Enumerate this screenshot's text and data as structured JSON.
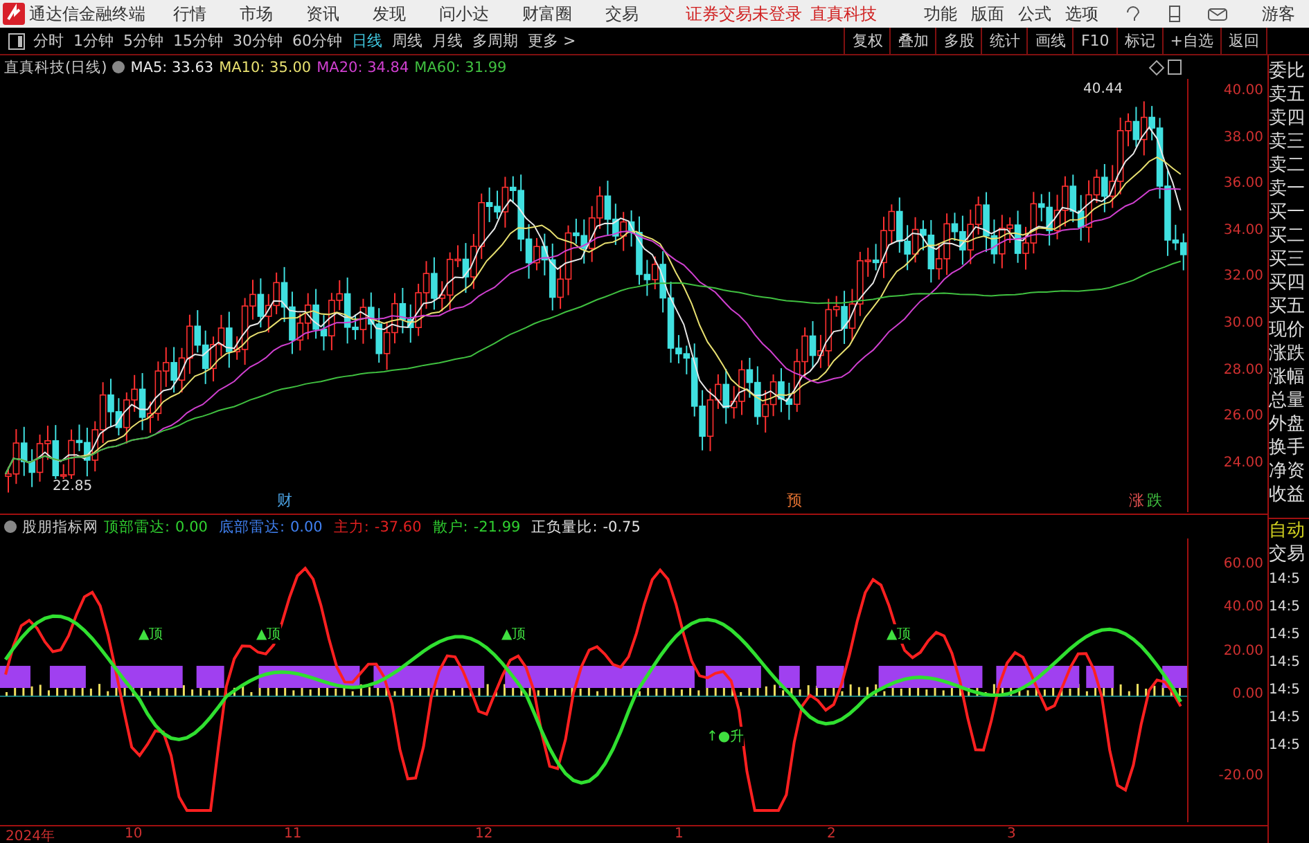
{
  "app_title": "通达信金融终端",
  "menu": [
    "行情",
    "市场",
    "资讯",
    "发现",
    "问小达",
    "财富圈",
    "交易"
  ],
  "login_notice": "证券交易未登录",
  "stock_link": "直真科技",
  "top_menu": [
    "功能",
    "版面",
    "公式",
    "选项"
  ],
  "user": "游客",
  "periods": [
    {
      "label": "分时",
      "selected": false
    },
    {
      "label": "1分钟",
      "selected": false
    },
    {
      "label": "5分钟",
      "selected": false
    },
    {
      "label": "15分钟",
      "selected": false
    },
    {
      "label": "30分钟",
      "selected": false
    },
    {
      "label": "60分钟",
      "selected": false
    },
    {
      "label": "日线",
      "selected": true
    },
    {
      "label": "周线",
      "selected": false
    },
    {
      "label": "月线",
      "selected": false
    },
    {
      "label": "多周期",
      "selected": false
    },
    {
      "label": "更多 >",
      "selected": false
    }
  ],
  "tools": [
    "复权",
    "叠加",
    "多股",
    "统计",
    "画线",
    "F10",
    "标记",
    "+自选",
    "返回"
  ],
  "main_chart": {
    "title": "直真科技(日线)",
    "indicators": [
      {
        "text": "MA5: 33.63",
        "color": "#e8e8e8"
      },
      {
        "text": "MA10: 35.00",
        "color": "#e8e070"
      },
      {
        "text": "MA20: 34.84",
        "color": "#d040d0"
      },
      {
        "text": "MA60: 31.99",
        "color": "#40c040"
      }
    ],
    "y_ticks": [
      "40.00",
      "38.00",
      "36.00",
      "34.00",
      "32.00",
      "30.00",
      "28.00",
      "26.00",
      "24.00"
    ],
    "high_label": "40.44",
    "low_label": "22.85",
    "markers": [
      {
        "text": "财",
        "color": "#4aa0e0"
      },
      {
        "text": "预",
        "color": "#e07030"
      },
      {
        "text": "涨",
        "color": "#e05050"
      },
      {
        "text": "跌",
        "color": "#40c040"
      }
    ]
  },
  "quote_labels": [
    "委比",
    "卖五",
    "卖四",
    "卖三",
    "卖二",
    "卖一",
    "买一",
    "买二",
    "买三",
    "买四",
    "买五",
    "现价",
    "涨跌",
    "涨幅",
    "总量",
    "外盘",
    "换手",
    "净资",
    "收益"
  ],
  "sub_chart": {
    "name": "股朋指标网",
    "values": [
      {
        "label": "顶部雷达:",
        "value": "0.00",
        "color": "#30d030"
      },
      {
        "label": "底部雷达:",
        "value": "0.00",
        "color": "#4080f0"
      },
      {
        "label": "主力:",
        "value": "-37.60",
        "color": "#e02020"
      },
      {
        "label": "散户:",
        "value": "-21.99",
        "color": "#30d030"
      },
      {
        "label": "正负量比:",
        "value": "-0.75",
        "color": "#e0e0e0"
      }
    ],
    "y_ticks": [
      "60.00",
      "40.00",
      "20.00",
      "0.00",
      "-20.00"
    ],
    "signals": [
      "▲顶",
      "▲顶",
      "▲顶",
      "▲顶",
      "↑●升"
    ]
  },
  "side_tabs": [
    "自动",
    "交易"
  ],
  "times": [
    "14:5",
    "14:5",
    "14:5",
    "14:5",
    "14:5",
    "14:5",
    "14:5"
  ],
  "x_axis": [
    "2024年",
    "10",
    "11",
    "12",
    "1",
    "2",
    "3"
  ]
}
